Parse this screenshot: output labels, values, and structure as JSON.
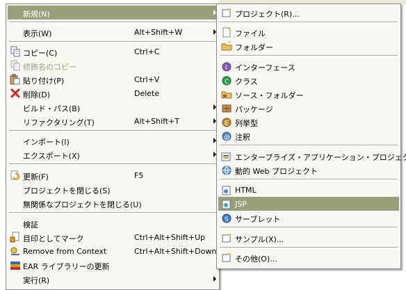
{
  "main_menu": {
    "items": [
      {
        "label": "新規(N)",
        "accel": "",
        "submenu": true,
        "selected": true,
        "icon": "none"
      },
      {
        "label": "表示(W)",
        "accel": "Alt+Shift+W",
        "submenu": true,
        "icon": "none"
      },
      {
        "label": "コピー(C)",
        "accel": "Ctrl+C",
        "icon": "copy-icon"
      },
      {
        "label": "修飾名のコピー",
        "accel": "",
        "disabled": true,
        "icon": "copy-qualified-icon"
      },
      {
        "label": "貼り付け(P)",
        "accel": "Ctrl+V",
        "icon": "paste-icon"
      },
      {
        "label": "削除(D)",
        "accel": "Delete",
        "icon": "delete-icon"
      },
      {
        "label": "ビルド・パス(B)",
        "accel": "",
        "submenu": true,
        "icon": "none"
      },
      {
        "label": "リファクタリング(T)",
        "accel": "Alt+Shift+T",
        "submenu": true,
        "icon": "none"
      },
      {
        "label": "インポート(I)",
        "accel": "",
        "submenu": true,
        "icon": "none"
      },
      {
        "label": "エクスポート(X)",
        "accel": "",
        "submenu": true,
        "icon": "none"
      },
      {
        "label": "更新(F)",
        "accel": "F5",
        "icon": "refresh-icon"
      },
      {
        "label": "プロジェクトを閉じる(S)",
        "accel": "",
        "icon": "none"
      },
      {
        "label": "無関係なプロジェクトを閉じる(U)",
        "accel": "",
        "icon": "none"
      },
      {
        "label": "検証",
        "accel": "",
        "icon": "none"
      },
      {
        "label": "目印としてマーク",
        "accel": "Ctrl+Alt+Shift+Up",
        "icon": "mark-landmark-icon"
      },
      {
        "label": "Remove from Context",
        "accel": "Ctrl+Alt+Shift+Down",
        "icon": "remove-context-icon"
      },
      {
        "label": "EAR ライブラリーの更新",
        "accel": "",
        "icon": "ear-library-icon"
      },
      {
        "label": "実行(R)",
        "accel": "",
        "submenu": true,
        "icon": "none"
      }
    ]
  },
  "sub_menu": {
    "items": [
      {
        "label": "プロジェクト(R)...",
        "icon": "new-project-icon"
      },
      {
        "label": "ファイル",
        "icon": "new-file-icon"
      },
      {
        "label": "フォルダー",
        "icon": "new-folder-icon"
      },
      {
        "label": "インターフェース",
        "icon": "new-interface-icon"
      },
      {
        "label": "クラス",
        "icon": "new-class-icon"
      },
      {
        "label": "ソース・フォルダー",
        "icon": "new-source-folder-icon"
      },
      {
        "label": "パッケージ",
        "icon": "new-package-icon"
      },
      {
        "label": "列挙型",
        "icon": "new-enum-icon"
      },
      {
        "label": "注釈",
        "icon": "new-annotation-icon"
      },
      {
        "label": "エンタープライズ・アプリケーション・プロジェクト",
        "icon": "new-ear-project-icon"
      },
      {
        "label": "動的 Web プロジェクト",
        "icon": "new-web-project-icon"
      },
      {
        "label": "HTML",
        "icon": "new-html-icon"
      },
      {
        "label": "JSP",
        "icon": "new-jsp-icon",
        "selected": true
      },
      {
        "label": "サーブレット",
        "icon": "new-servlet-icon"
      },
      {
        "label": "サンプル(X)...",
        "icon": "new-sample-icon"
      },
      {
        "label": "その他(O)...",
        "icon": "new-other-icon"
      }
    ]
  },
  "colors": {
    "selection": "#98a07a",
    "menu_background": "#f8f7f2"
  }
}
